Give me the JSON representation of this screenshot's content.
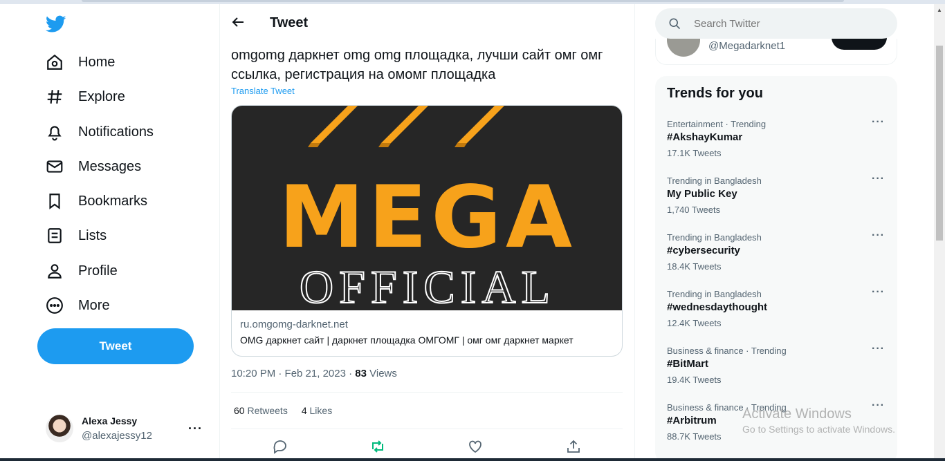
{
  "sidebar": {
    "logo": "twitter-bird-icon",
    "items": [
      {
        "label": "Home",
        "icon": "home-icon"
      },
      {
        "label": "Explore",
        "icon": "hashtag-icon"
      },
      {
        "label": "Notifications",
        "icon": "bell-icon"
      },
      {
        "label": "Messages",
        "icon": "envelope-icon"
      },
      {
        "label": "Bookmarks",
        "icon": "bookmark-icon"
      },
      {
        "label": "Lists",
        "icon": "list-icon"
      },
      {
        "label": "Profile",
        "icon": "person-icon"
      },
      {
        "label": "More",
        "icon": "more-circle-icon"
      }
    ],
    "tweet_button": "Tweet",
    "account": {
      "name": "Alexa Jessy",
      "handle": "@alexajessy12"
    }
  },
  "header": {
    "title": "Tweet"
  },
  "tweet": {
    "text": "omgomg даркнет omg omg площадка, лучши сайт омг омг ссылка, регистрация на омомг площадка",
    "translate": "Translate Tweet",
    "card": {
      "image_text_main": "MEGA",
      "image_text_sub": "OFFICIAL",
      "domain": "ru.omgomg-darknet.net",
      "title": "OMG даркнет сайт | даркнет площадка ОМГОМГ | омг омг даркнет маркет"
    },
    "timestamp": "10:20 PM · Feb 21, 2023 · ",
    "views_count": "83",
    "views_label": " Views",
    "retweets_count": "60",
    "retweets_label": " Retweets",
    "likes_count": "4",
    "likes_label": " Likes"
  },
  "search": {
    "placeholder": "Search Twitter"
  },
  "who_to_follow": {
    "handle": "@Megadarknet1"
  },
  "trends": {
    "title": "Trends for you",
    "items": [
      {
        "context": "Entertainment · Trending",
        "name": "#AkshayKumar",
        "count": "17.1K Tweets"
      },
      {
        "context": "Trending in Bangladesh",
        "name": "My Public Key",
        "count": "1,740 Tweets"
      },
      {
        "context": "Trending in Bangladesh",
        "name": "#cybersecurity",
        "count": "18.4K Tweets"
      },
      {
        "context": "Trending in Bangladesh",
        "name": "#wednesdaythought",
        "count": "12.4K Tweets"
      },
      {
        "context": "Business & finance · Trending",
        "name": "#BitMart",
        "count": "19.4K Tweets"
      },
      {
        "context": "Business & finance · Trending",
        "name": "#Arbitrum",
        "count": "88.7K Tweets"
      }
    ]
  },
  "watermark": {
    "line1": "Activate Windows",
    "line2": "Go to Settings to activate Windows."
  },
  "colors": {
    "accent": "#1d9bf0",
    "retweet_green": "#00ba7c",
    "mega_orange": "#f7a21b",
    "card_bg": "#262626"
  }
}
